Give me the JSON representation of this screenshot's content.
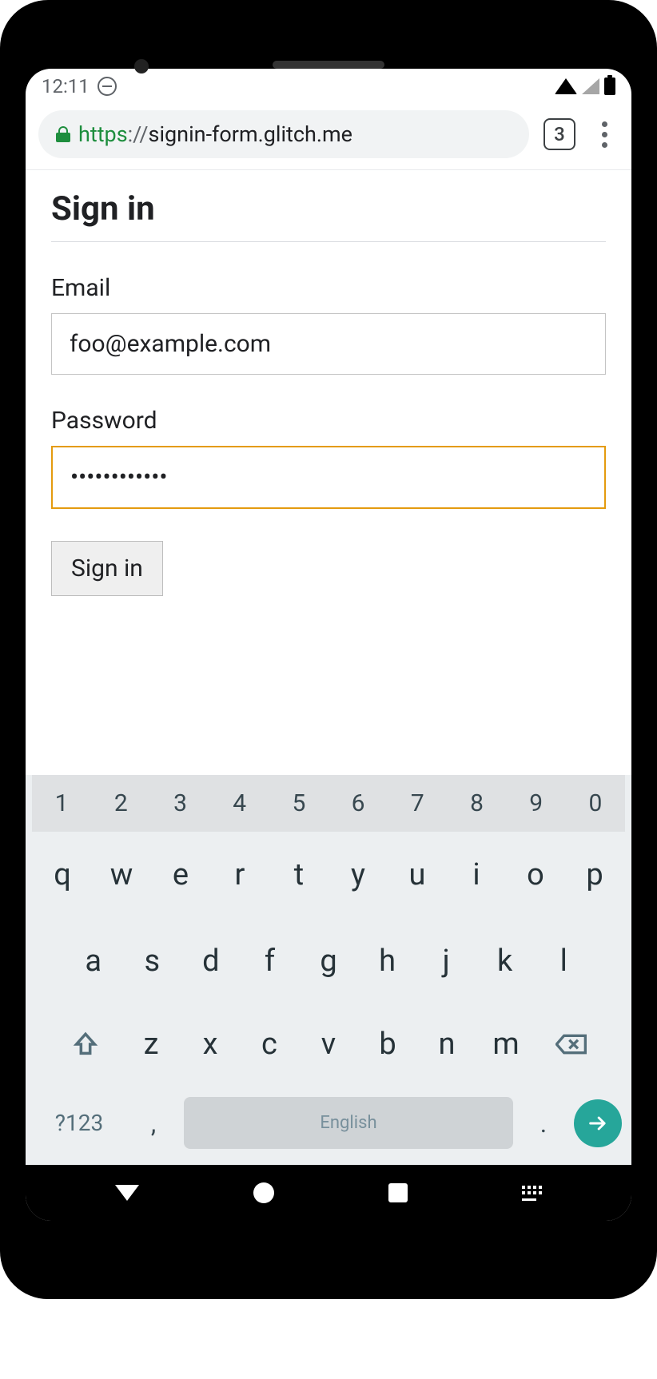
{
  "status_bar": {
    "time": "12:11"
  },
  "browser": {
    "url_scheme": "https",
    "url_sep": "://",
    "url_host": "signin-form.glitch.me",
    "tab_count": "3"
  },
  "page": {
    "title": "Sign in",
    "email_label": "Email",
    "email_value": "foo@example.com",
    "password_label": "Password",
    "password_value": "••••••••••••",
    "submit_label": "Sign in"
  },
  "keyboard": {
    "numbers": [
      "1",
      "2",
      "3",
      "4",
      "5",
      "6",
      "7",
      "8",
      "9",
      "0"
    ],
    "row1": [
      "q",
      "w",
      "e",
      "r",
      "t",
      "y",
      "u",
      "i",
      "o",
      "p"
    ],
    "row2": [
      "a",
      "s",
      "d",
      "f",
      "g",
      "h",
      "j",
      "k",
      "l"
    ],
    "row3": [
      "z",
      "x",
      "c",
      "v",
      "b",
      "n",
      "m"
    ],
    "symbols_label": "?123",
    "comma": ",",
    "dot": ".",
    "space_label": "English"
  }
}
